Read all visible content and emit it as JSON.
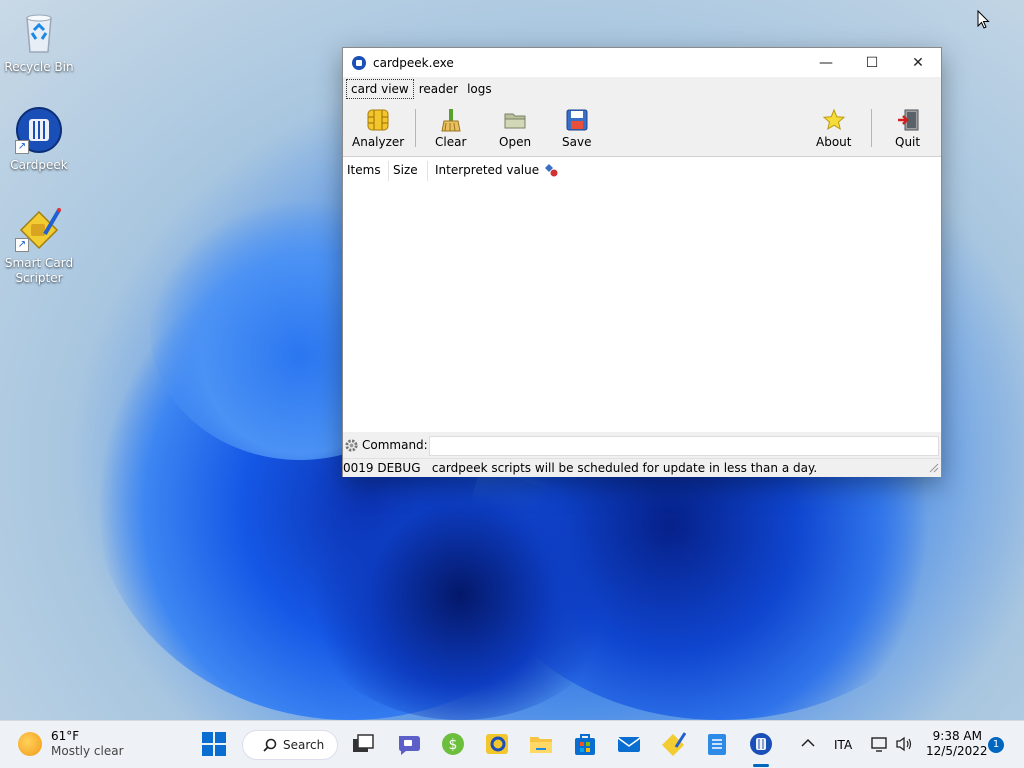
{
  "desktop": {
    "icons": [
      {
        "label": "Recycle Bin"
      },
      {
        "label": "Cardpeek"
      },
      {
        "label": "Smart Card Scripter"
      }
    ]
  },
  "window": {
    "title": "cardpeek.exe",
    "controls": {
      "minimize": "—",
      "maximize": "☐",
      "close": "✕"
    },
    "tabs": [
      "card view",
      "reader",
      "logs"
    ],
    "toolbar": {
      "analyzer": "Analyzer",
      "clear": "Clear",
      "open": "Open",
      "save": "Save",
      "about": "About",
      "quit": "Quit"
    },
    "columns": [
      "Items",
      "Size",
      "Interpreted value"
    ],
    "command_label": "Command:",
    "command_value": "",
    "status": "0019 DEBUG   cardpeek scripts will be scheduled for update in less than a day."
  },
  "taskbar": {
    "weather_temp": "61°F",
    "weather_condition": "Mostly clear",
    "search_label": "Search",
    "language": "ITA",
    "time": "9:38 AM",
    "date": "12/5/2022",
    "notification_count": "1"
  }
}
